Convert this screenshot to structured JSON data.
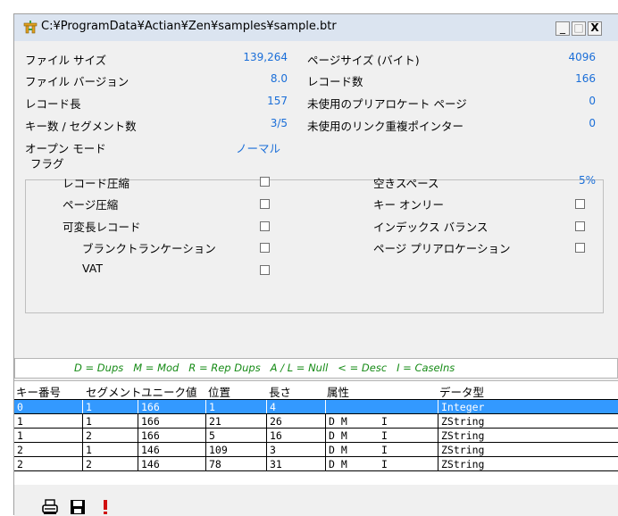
{
  "window": {
    "title": "C:¥ProgramData¥Actian¥Zen¥samples¥sample.btr",
    "min_label": "_",
    "max_label": "□",
    "close_label": "X"
  },
  "stats": {
    "file_size_label": "ファイル サイズ",
    "file_size_value": "139,264",
    "file_version_label": "ファイル バージョン",
    "file_version_value": "8.0",
    "record_length_label": "レコード長",
    "record_length_value": "157",
    "keys_segments_label": "キー数 / セグメント数",
    "keys_segments_value": "3/5",
    "open_mode_label": "オープン モード",
    "open_mode_value": "ノーマル",
    "page_size_label": "ページサイズ (バイト)",
    "page_size_value": "4096",
    "record_count_label": "レコード数",
    "record_count_value": "166",
    "unused_prealloc_label": "未使用のプリアロケート ページ",
    "unused_prealloc_value": "0",
    "unused_dup_label": "未使用のリンク重複ポインター",
    "unused_dup_value": "0"
  },
  "flags": {
    "title": "フラグ",
    "record_compression": "レコード圧縮",
    "page_compression": "ページ圧縮",
    "variable_record": "可変長レコード",
    "blank_truncation": "ブランクトランケーション",
    "vat": "VAT",
    "free_space_label": "空きスペース",
    "free_space_value": "5%",
    "key_only": "キー オンリー",
    "index_balance": "インデックス バランス",
    "page_prealloc": "ページ プリアロケーション"
  },
  "legend": "D = Dups   M = Mod   R = Rep Dups   A / L = Null   < = Desc   I = CaseIns",
  "table": {
    "headers": [
      "キー番号",
      "セグメント",
      "ユニーク値",
      "位置",
      "長さ",
      "属性",
      "データ型"
    ],
    "rows": [
      {
        "key": "0",
        "seg": "1",
        "unique": "166",
        "pos": "1",
        "len": "4",
        "attr": "",
        "attr2": "",
        "type": "Integer"
      },
      {
        "key": "1",
        "seg": "1",
        "unique": "166",
        "pos": "21",
        "len": "26",
        "attr": "D M",
        "attr2": "I",
        "type": "ZString"
      },
      {
        "key": "1",
        "seg": "2",
        "unique": "166",
        "pos": "5",
        "len": "16",
        "attr": "D M",
        "attr2": "I",
        "type": "ZString"
      },
      {
        "key": "2",
        "seg": "1",
        "unique": "146",
        "pos": "109",
        "len": "3",
        "attr": "D M",
        "attr2": "I",
        "type": "ZString"
      },
      {
        "key": "2",
        "seg": "2",
        "unique": "146",
        "pos": "78",
        "len": "31",
        "attr": "D M",
        "attr2": "I",
        "type": "ZString"
      }
    ]
  },
  "toolbar": {
    "print_icon": "printer-icon",
    "save_icon": "save-icon",
    "alert_icon": "exclamation-icon"
  },
  "colors": {
    "value_blue": "#1a6ed8",
    "legend_green": "#168b16",
    "selection": "#3399ff",
    "alert_red": "#d01010"
  }
}
